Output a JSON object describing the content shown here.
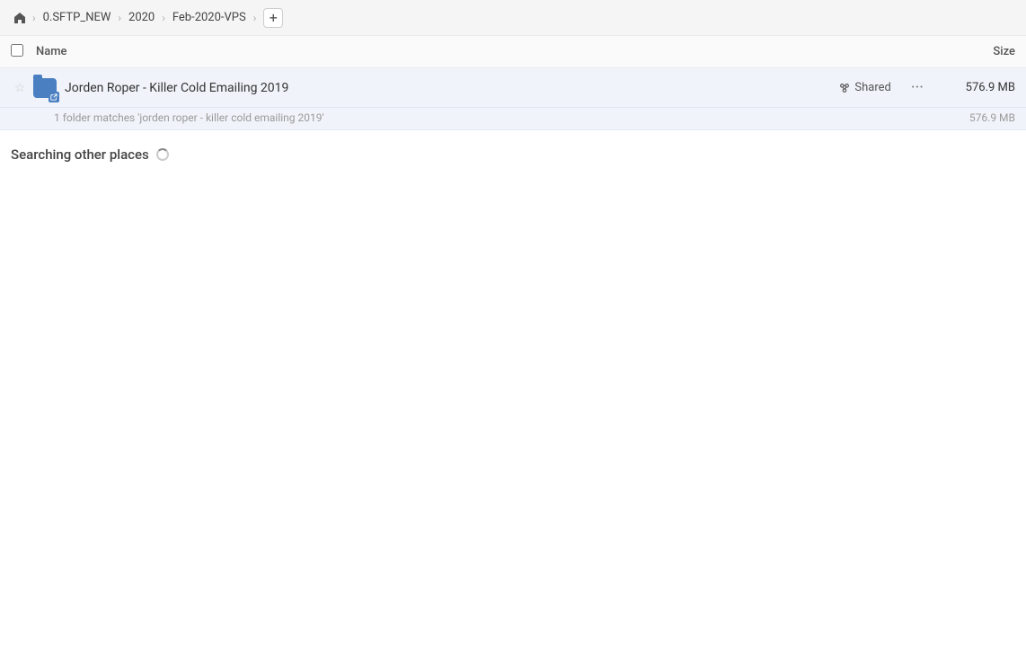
{
  "header": {
    "home_icon": "home",
    "breadcrumb": [
      {
        "label": "0.SFTP_NEW"
      },
      {
        "label": "2020"
      },
      {
        "label": "Feb-2020-VPS"
      }
    ],
    "add_button_label": "+"
  },
  "table": {
    "col_name": "Name",
    "col_size": "Size"
  },
  "file_row": {
    "name": "Jorden Roper - Killer Cold Emailing 2019",
    "shared_label": "Shared",
    "size": "576.9 MB",
    "match_text": "1 folder matches 'jorden roper - killer cold emailing 2019'",
    "match_size": "576.9 MB"
  },
  "searching": {
    "title": "Searching other places"
  }
}
